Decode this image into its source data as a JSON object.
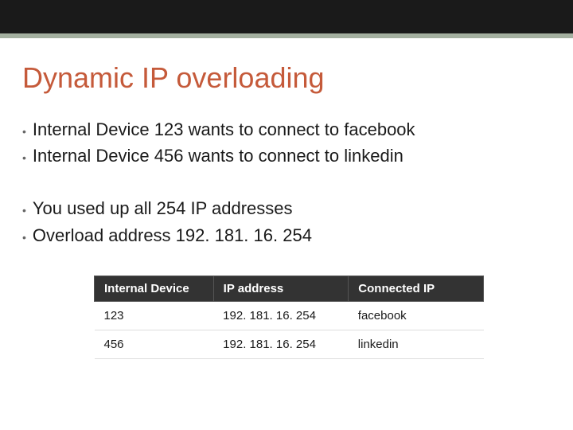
{
  "title": "Dynamic IP overloading",
  "group1": {
    "items": [
      "Internal Device 123 wants to connect to facebook",
      "Internal Device 456 wants to connect to linkedin"
    ]
  },
  "group2": {
    "items": [
      "You used up all 254 IP addresses",
      "Overload address  192. 181. 16. 254"
    ]
  },
  "table": {
    "headers": [
      "Internal Device",
      "IP address",
      "Connected IP"
    ],
    "rows": [
      {
        "device": "123",
        "ip": "192. 181. 16. 254",
        "connected": "facebook"
      },
      {
        "device": "456",
        "ip": "192. 181. 16. 254",
        "connected": "linkedin"
      }
    ]
  }
}
